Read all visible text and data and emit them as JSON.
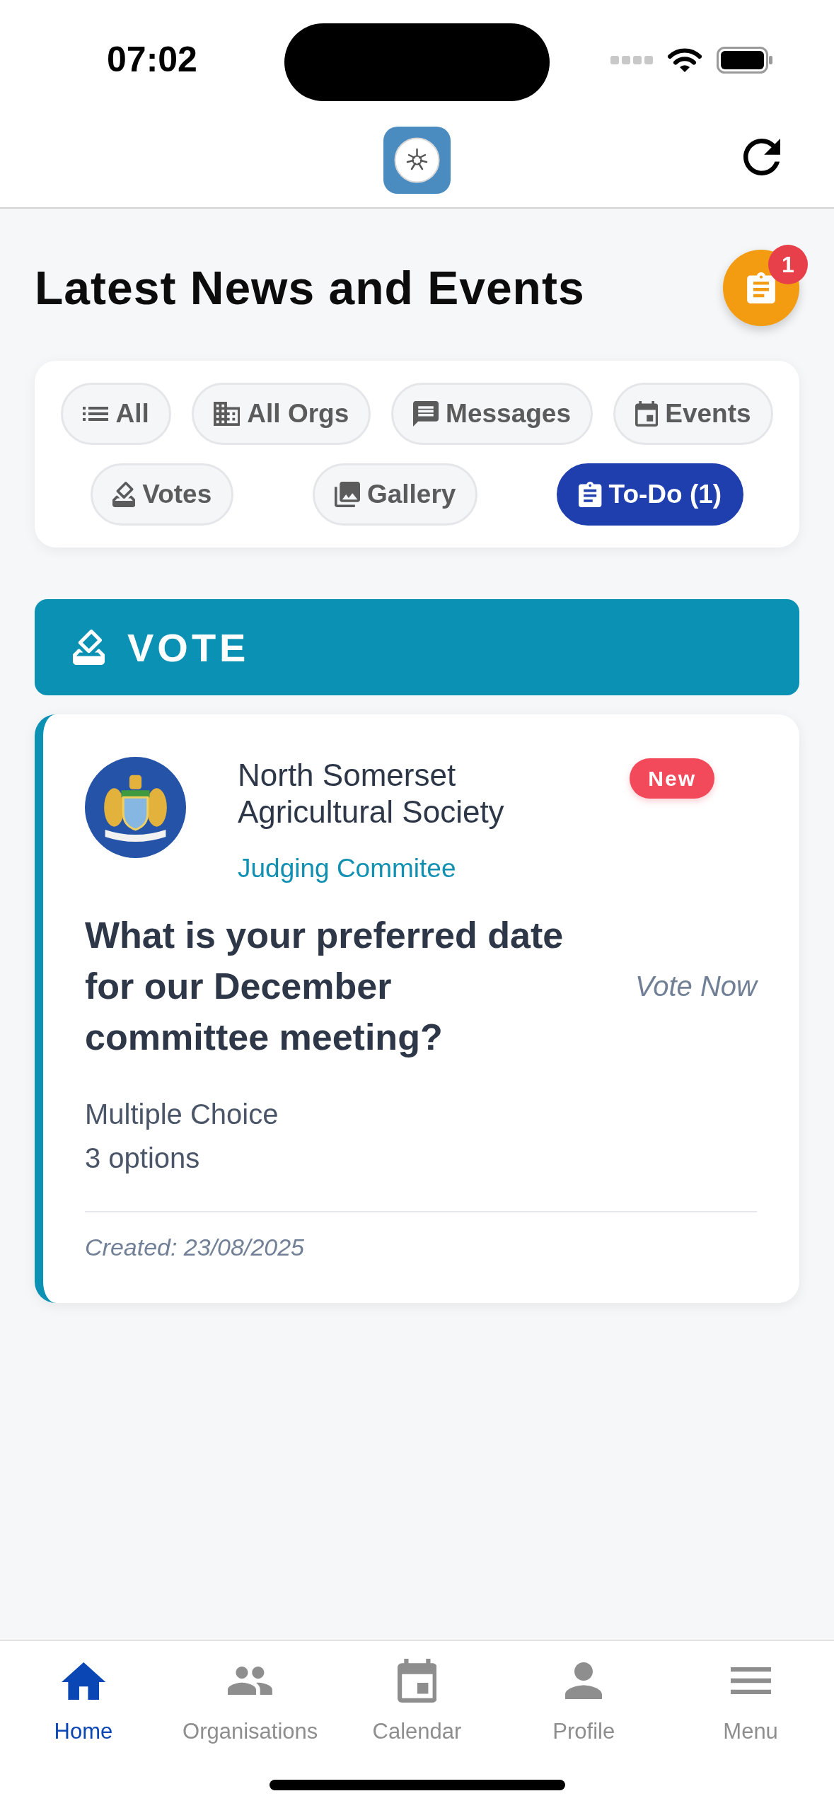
{
  "status_bar": {
    "time": "07:02"
  },
  "page": {
    "title": "Latest News and Events",
    "todo_badge": "1"
  },
  "filters": [
    {
      "label": "All",
      "selected": false
    },
    {
      "label": "All Orgs",
      "selected": false
    },
    {
      "label": "Messages",
      "selected": false
    },
    {
      "label": "Events",
      "selected": false
    },
    {
      "label": "Votes",
      "selected": false
    },
    {
      "label": "Gallery",
      "selected": false
    },
    {
      "label": "To-Do (1)",
      "selected": true
    }
  ],
  "section": {
    "title": "VOTE"
  },
  "vote_card": {
    "organisation": "North Somerset Agricultural Society",
    "badge": "New",
    "group": "Judging Commitee",
    "question": "What is your preferred date for our December committee meeting?",
    "action": "Vote Now",
    "vote_type": "Multiple Choice",
    "options": "3 options",
    "created": "Created: 23/08/2025"
  },
  "bottom_nav": [
    {
      "label": "Home",
      "selected": true
    },
    {
      "label": "Organisations",
      "selected": false
    },
    {
      "label": "Calendar",
      "selected": false
    },
    {
      "label": "Profile",
      "selected": false
    },
    {
      "label": "Menu",
      "selected": false
    }
  ]
}
